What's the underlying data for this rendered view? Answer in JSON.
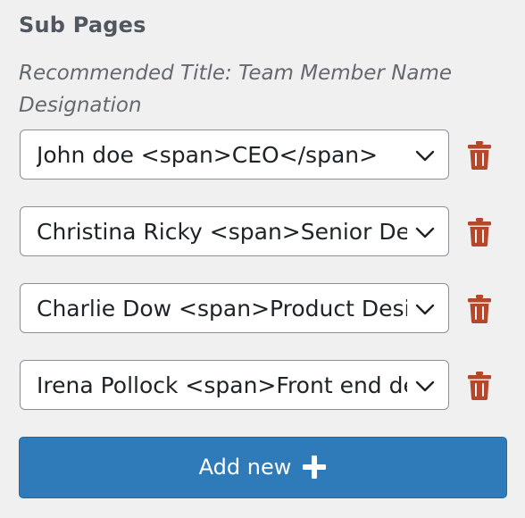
{
  "section": {
    "title": "Sub Pages",
    "hint": "Recommended Title: Team Member Name Designation"
  },
  "sub_pages": [
    {
      "value": "John doe <span>CEO</span>"
    },
    {
      "value": "Christina Ricky <span>Senior Designer</span>"
    },
    {
      "value": "Charlie Dow <span>Product Designer</span>"
    },
    {
      "value": "Irena Pollock <span>Front end developer</span>"
    }
  ],
  "actions": {
    "add_label": "Add new"
  },
  "icons": {
    "select_caret": "chevron-down-icon",
    "delete": "trash-icon",
    "add": "plus-icon"
  },
  "colors": {
    "background": "#f0f0f1",
    "delete_icon": "#b5472b",
    "primary_button": "#2f7bb9",
    "title_text": "#50575e"
  }
}
